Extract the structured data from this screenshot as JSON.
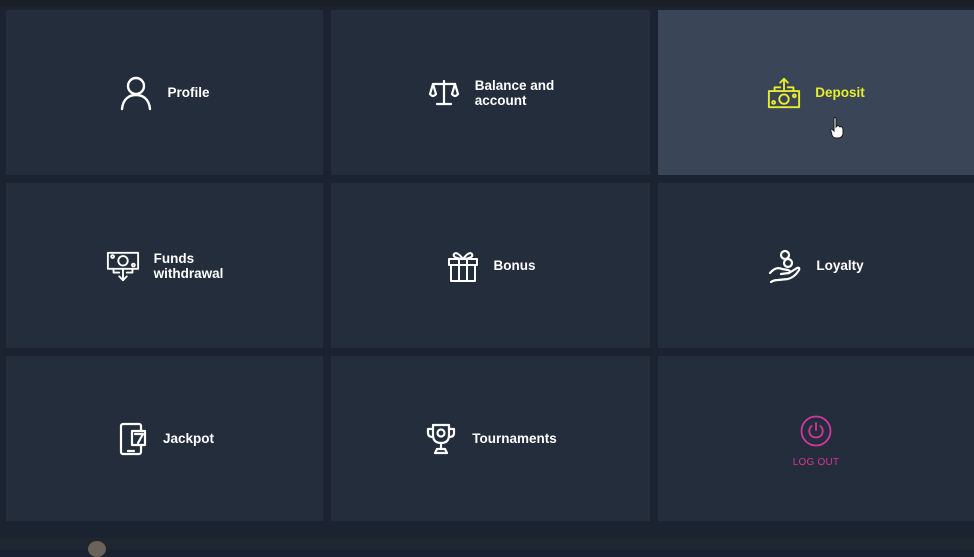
{
  "menu": {
    "items": [
      {
        "label": "Profile",
        "icon": "user-icon"
      },
      {
        "label": "Balance and\naccount",
        "icon": "scales-icon"
      },
      {
        "label": "Deposit",
        "icon": "deposit-money-icon",
        "active": true
      },
      {
        "label": "Funds\nwithdrawal",
        "icon": "withdraw-money-icon"
      },
      {
        "label": "Bonus",
        "icon": "gift-icon"
      },
      {
        "label": "Loyalty",
        "icon": "hand-coins-icon"
      },
      {
        "label": "Jackpot",
        "icon": "phone-seven-icon"
      },
      {
        "label": "Tournaments",
        "icon": "trophy-icon"
      },
      {
        "label": "LOG OUT",
        "icon": "power-icon"
      }
    ]
  },
  "colors": {
    "background": "#1b2330",
    "tile": "#232d3c",
    "tile_active": "#3a4558",
    "active_text": "#e6ee2e",
    "logout": "#d5369c"
  }
}
